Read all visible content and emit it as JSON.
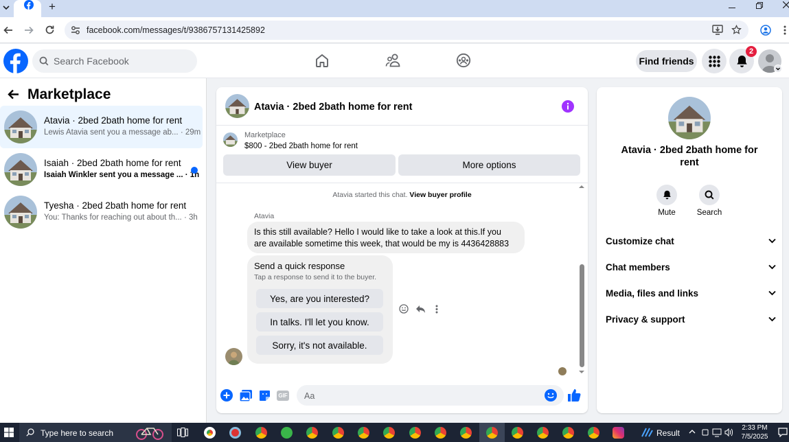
{
  "browser": {
    "url": "facebook.com/messages/t/9386757131425892",
    "new_tab_symbol": "+"
  },
  "fb": {
    "search_placeholder": "Search Facebook",
    "find_friends": "Find friends",
    "notification_count": "2"
  },
  "left": {
    "title": "Marketplace",
    "conversations": [
      {
        "title": "Atavia · 2bed 2bath home for rent",
        "snippet": "Lewis Atavia sent you a message ab...",
        "time": "· 29m",
        "unread": false,
        "selected": true
      },
      {
        "title": "Isaiah · 2bed 2bath home for rent",
        "snippet": "Isaiah Winkler sent you a message ...",
        "time": "· 1h",
        "unread": true,
        "selected": false
      },
      {
        "title": "Tyesha · 2bed 2bath home for rent",
        "snippet": "You: Thanks for reaching out about th...",
        "time": "· 3h",
        "unread": false,
        "selected": false
      }
    ]
  },
  "chat": {
    "title": "Atavia · 2bed 2bath home for rent",
    "listing": {
      "source": "Marketplace",
      "price_title": "$800 - 2bed 2bath home for rent"
    },
    "view_buyer": "View buyer",
    "more_options": "More options",
    "started_text": "Atavia started this chat.",
    "view_buyer_profile": "View buyer profile",
    "sender_name": "Atavia",
    "message_line1": "Is this still available? Hello I would like to take a look at this.If you",
    "message_line2": "are available sometime this week, that would be my is 4436428883",
    "quick_title": "Send a quick response",
    "quick_subtitle": "Tap a response to send it to the buyer.",
    "quick_responses": [
      "Yes, are you interested?",
      "In talks. I'll let you know.",
      "Sorry, it's not available."
    ],
    "input_placeholder": "Aa",
    "gif_label": "GIF"
  },
  "right": {
    "title": "Atavia · 2bed 2bath home for rent",
    "mute": "Mute",
    "search": "Search",
    "sections": [
      "Customize chat",
      "Chat members",
      "Media, files and links",
      "Privacy & support"
    ]
  },
  "taskbar": {
    "search_placeholder": "Type here to search",
    "weather": "Result",
    "time": "2:33 PM",
    "date": "7/5/2025"
  },
  "colors": {
    "fb_blue": "#0866ff",
    "messenger_purple": "#a033ff",
    "notif_red": "#e41e3f",
    "selected_row": "#ebf5ff"
  }
}
